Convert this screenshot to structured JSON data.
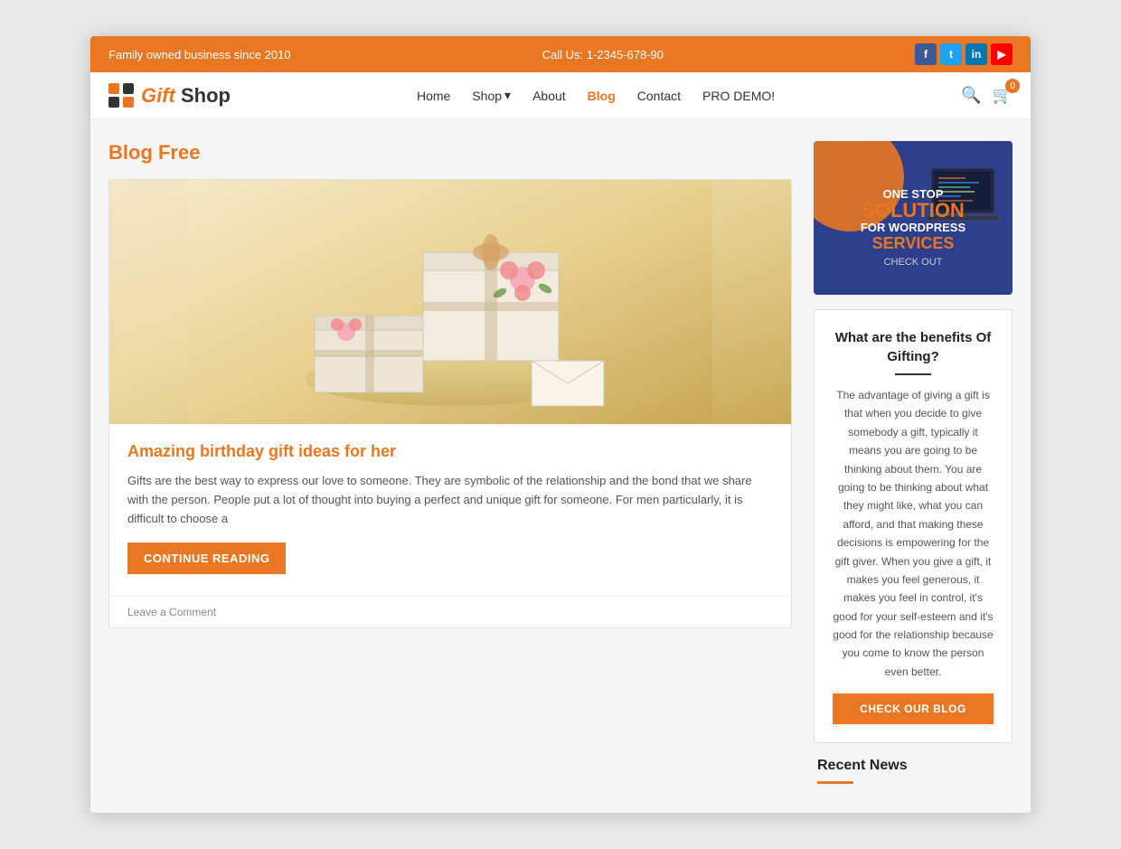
{
  "topbar": {
    "left": "Family owned business since 2010",
    "center": "Call Us: 1-2345-678-90",
    "social": [
      "f",
      "t",
      "in",
      "▶"
    ]
  },
  "navbar": {
    "logo_gift": "Gift",
    "logo_shop": " Shop",
    "links": [
      {
        "label": "Home",
        "href": "#",
        "active": false,
        "dropdown": false
      },
      {
        "label": "Shop",
        "href": "#",
        "active": false,
        "dropdown": true
      },
      {
        "label": "About",
        "href": "#",
        "active": false,
        "dropdown": false
      },
      {
        "label": "Blog",
        "href": "#",
        "active": true,
        "dropdown": false
      },
      {
        "label": "Contact",
        "href": "#",
        "active": false,
        "dropdown": false
      },
      {
        "label": "PRO DEMO!",
        "href": "#",
        "active": false,
        "dropdown": false
      }
    ],
    "cart_count": "0"
  },
  "blog": {
    "page_title": "Blog Free",
    "post": {
      "title": "Amazing birthday gift ideas for her",
      "excerpt": "Gifts are the best way to express our love to someone. They are symbolic of the relationship and the bond that we share with the person. People put a lot of thought into buying a perfect and unique gift for someone. For men particularly, it is difficult to choose a",
      "continue_btn": "CONTINUE READING",
      "leave_comment": "Leave a Comment"
    }
  },
  "sidebar": {
    "ad": {
      "one_stop": "ONE STOP",
      "solution": "SOLUTION",
      "for_wordpress": "FOR WORDPRESS",
      "services": "SERVICES",
      "check_out": "CHECK OUT"
    },
    "widget": {
      "title": "What are the benefits Of Gifting?",
      "text": "The advantage of giving a gift is that when you decide to give somebody a gift, typically it means you are going to be thinking about them. You are going to be thinking about what they might like, what you can afford, and that making these decisions is empowering for the gift giver. When you give a gift, it makes you feel generous, it makes you feel in control, it's good for your self-esteem and it's good for the relationship because you come to know the person even better.",
      "btn_label": "CHECK OUR BLOG"
    },
    "recent_news": {
      "title": "Recent News"
    }
  }
}
